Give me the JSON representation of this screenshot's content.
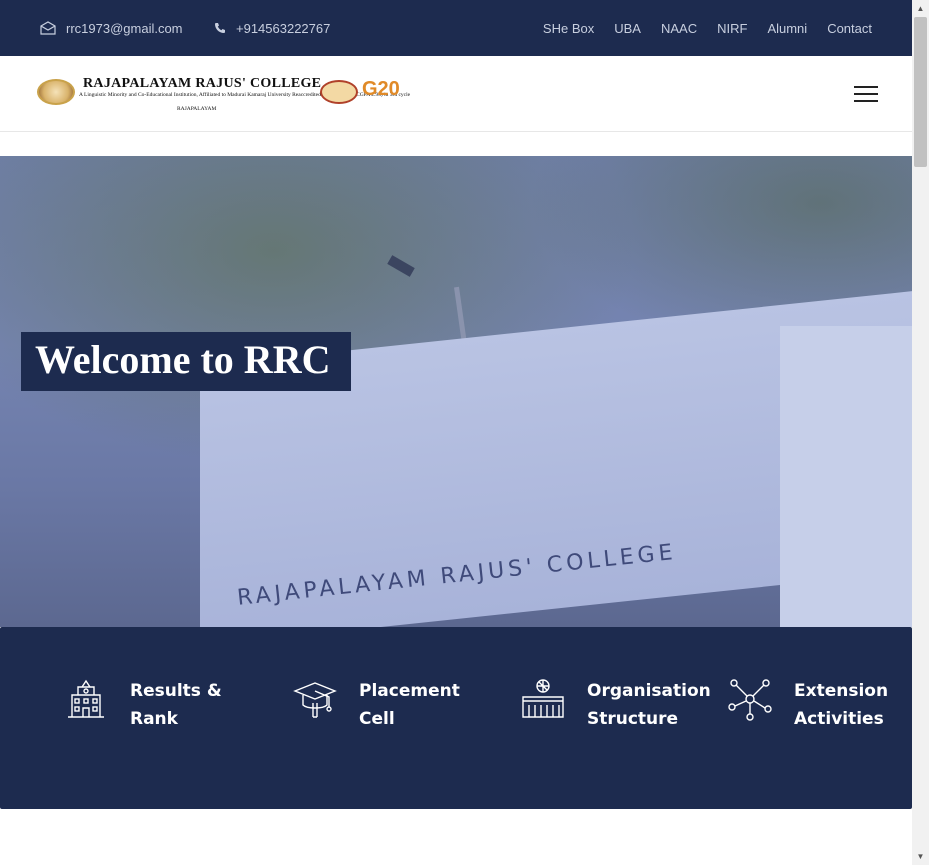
{
  "topbar": {
    "email": "rrc1973@gmail.com",
    "phone": "+914563222767",
    "links": [
      "SHe Box",
      "UBA",
      "NAAC",
      "NIRF",
      "Alumni",
      "Contact"
    ]
  },
  "header": {
    "logo": {
      "name": "RAJAPALAYAM RAJUS' COLLEGE",
      "subtitle": "A Linguistic Minority and Co-Educational Institution, Affiliated to Madurai Kamaraj University Reaccredited B+ by NAAC (CGPA 2.93) in 3rd cycle",
      "place": "RAJAPALAYAM",
      "g20": "G20"
    }
  },
  "hero": {
    "heading": "Welcome to RRC",
    "building_text": "RAJAPALAYAM RAJUS' COLLEGE"
  },
  "features": [
    {
      "label": "Results & Rank",
      "icon": "school-building-icon"
    },
    {
      "label": "Placement Cell",
      "icon": "graduation-cap-icon"
    },
    {
      "label": "Organisation Structure",
      "icon": "gym-building-icon"
    },
    {
      "label": "Extension Activities",
      "icon": "network-nodes-icon"
    }
  ],
  "colors": {
    "navy": "#1d2b4f",
    "white": "#ffffff"
  }
}
